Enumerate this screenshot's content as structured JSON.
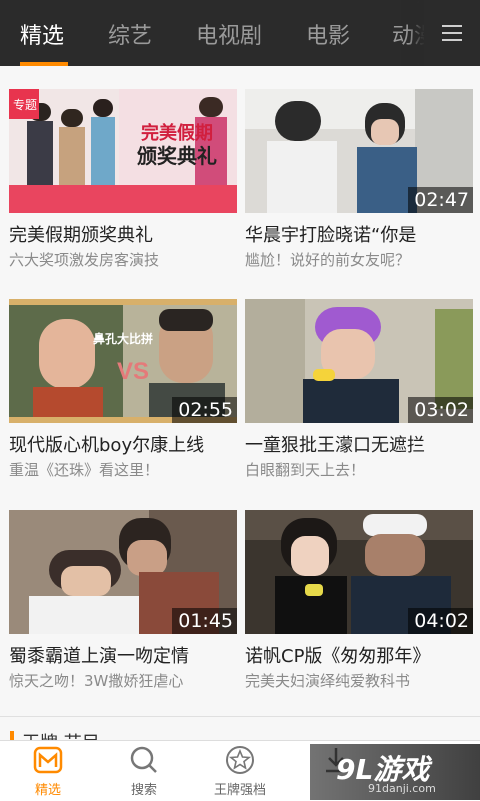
{
  "tabs": [
    {
      "label": "精选"
    },
    {
      "label": "综艺"
    },
    {
      "label": "电视剧"
    },
    {
      "label": "电影"
    },
    {
      "label": "动漫"
    }
  ],
  "menu_icon": "menu-icon",
  "thumb_texts": {
    "special_badge": "专题",
    "poster_title_1": "完美假期",
    "poster_title_2": "颁奖典礼",
    "vs_caption": "鼻孔大比拼",
    "vs_text": "VS"
  },
  "cards": [
    {
      "title": "完美假期颁奖典礼",
      "subtitle": "六大奖项激发房客演技",
      "duration": ""
    },
    {
      "title": "华晨宇打脸晓诺“你是",
      "subtitle": "尴尬！说好的前女友呢？",
      "duration": "02:47"
    },
    {
      "title": "现代版心机boy尔康上线",
      "subtitle": "重温《还珠》看这里！",
      "duration": "02:55"
    },
    {
      "title": "一童狠批王濛口无遮拦",
      "subtitle": "白眼翻到天上去！",
      "duration": "03:02"
    },
    {
      "title": "蜀黍霸道上演一吻定情",
      "subtitle": "惊天之吻！3W撒娇狂虐心",
      "duration": "01:45"
    },
    {
      "title": "诺帆CP版《匆匆那年》",
      "subtitle": "完美夫妇演绎纯爱教科书",
      "duration": "04:02"
    }
  ],
  "section_peek": {
    "label": "王牌 节目"
  },
  "bottom_nav": [
    {
      "label": "精选",
      "icon": "featured-icon",
      "active": true
    },
    {
      "label": "搜索",
      "icon": "search-icon",
      "active": false
    },
    {
      "label": "王牌强档",
      "icon": "star-icon",
      "active": false
    },
    {
      "label": "",
      "icon": "download-icon",
      "active": false
    }
  ],
  "watermark": {
    "big": "9L游戏",
    "small": "91danji.com"
  },
  "colors": {
    "accent": "#ff8a00",
    "topbar": "#2b2b2b",
    "badge": "#e8344e"
  }
}
